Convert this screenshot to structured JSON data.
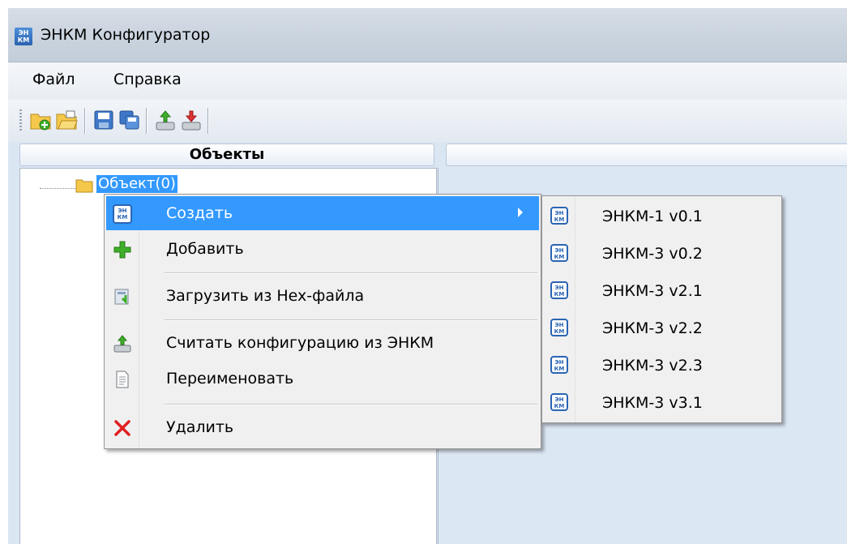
{
  "window": {
    "title": "ЭНКМ Конфигуратор",
    "app_icon_text": "ЭН КМ"
  },
  "menubar": {
    "items": [
      {
        "label": "Файл"
      },
      {
        "label": "Справка"
      }
    ]
  },
  "panels": {
    "objects_header": "Объекты"
  },
  "tree": {
    "root_label": "Объект(0)"
  },
  "context_menu": {
    "items": [
      {
        "label": "Создать",
        "icon": "enkm-icon",
        "selected": true,
        "has_submenu": true
      },
      {
        "label": "Добавить",
        "icon": "plus-icon"
      },
      {
        "label": "Загрузить из Hex-файла",
        "icon": "load-hex-icon"
      },
      {
        "label": "Считать конфигурацию из ЭНКМ",
        "icon": "read-config-icon"
      },
      {
        "label": "Переименовать",
        "icon": "document-icon"
      },
      {
        "label": "Удалить",
        "icon": "delete-x-icon"
      }
    ]
  },
  "submenu": {
    "items": [
      {
        "label": "ЭНКМ-1 v0.1"
      },
      {
        "label": "ЭНКМ-3 v0.2"
      },
      {
        "label": "ЭНКМ-3 v2.1"
      },
      {
        "label": "ЭНКМ-3 v2.2"
      },
      {
        "label": "ЭНКМ-3 v2.3"
      },
      {
        "label": "ЭНКМ-3 v3.1"
      }
    ]
  },
  "colors": {
    "selection": "#3399ff",
    "workspace": "#dce7f4",
    "delete_red": "#e02020",
    "add_green": "#3fae2a"
  }
}
